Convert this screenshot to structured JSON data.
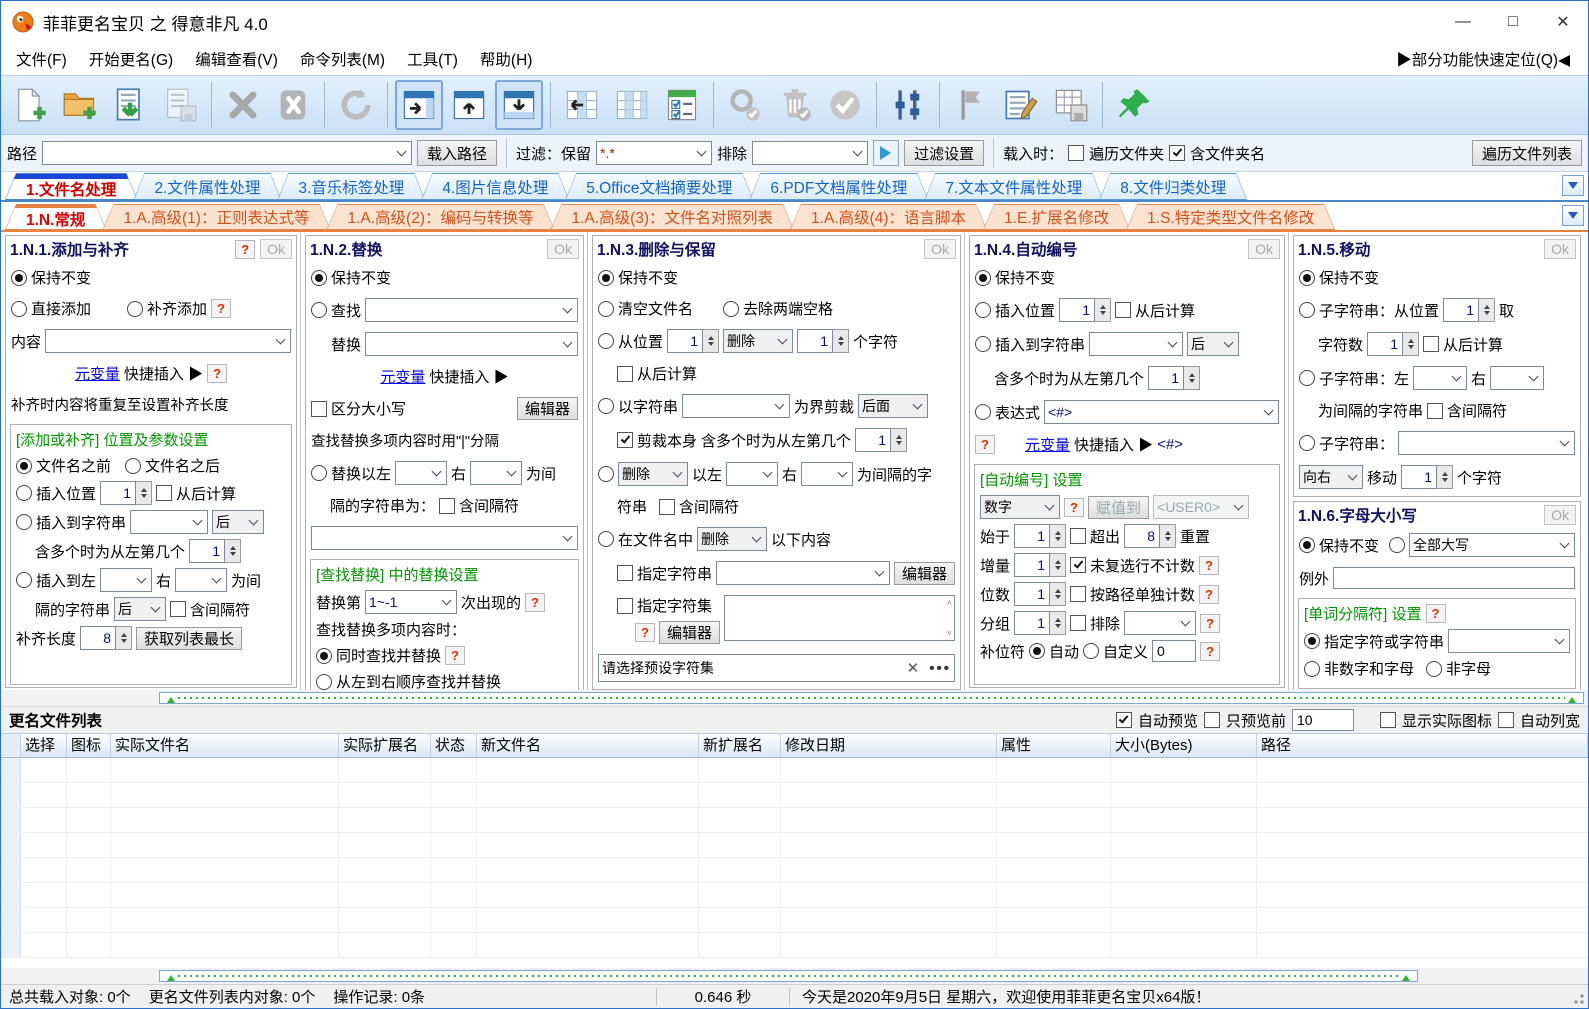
{
  "window": {
    "title": "菲菲更名宝贝 之 得意非凡 4.0",
    "minimize": "—",
    "maximize": "□",
    "close": "✕"
  },
  "menu": {
    "items": [
      "文件(F)",
      "开始更名(G)",
      "编辑查看(V)",
      "命令列表(M)",
      "工具(T)",
      "帮助(H)"
    ],
    "quick": "▶部分功能快速定位(Q)◀"
  },
  "toolbar": {
    "icons": [
      "add-files",
      "add-folder",
      "load-file-list",
      "save-file-list",
      "remove",
      "remove-all",
      "refresh",
      "panel-right",
      "panel-top",
      "panel-bottom",
      "grid-left",
      "grid-columns",
      "options-checklist",
      "search-files",
      "clean-invalid",
      "apply-check",
      "adjust-options",
      "flag-mark",
      "edit-commands",
      "table-save",
      "pin-top"
    ]
  },
  "pathbar": {
    "path_label": "路径",
    "load_path": "载入路径",
    "filter_label": "过滤：保留",
    "keep": "*.*",
    "exclude": "排除",
    "filter_set": "过滤设置",
    "on_load": "载入时：",
    "walk_folders": "遍历文件夹",
    "with_folder_name": "含文件夹名",
    "walk_list": "遍历文件列表"
  },
  "main_tabs": [
    "1.文件名处理",
    "2.文件属性处理",
    "3.音乐标签处理",
    "4.图片信息处理",
    "5.Office文档摘要处理",
    "6.PDF文档属性处理",
    "7.文本文件属性处理",
    "8.文件归类处理"
  ],
  "sub_tabs": [
    "1.N.常规",
    "1.A.高级(1)：正则表达式等",
    "1.A.高级(2)：编码与转换等",
    "1.A.高级(3)：文件名对照列表",
    "1.A.高级(4)：语言脚本",
    "1.E.扩展名修改",
    "1.S.特定类型文件名修改"
  ],
  "c": {
    "ok": "Ok",
    "help": "?",
    "keep": "保持不变",
    "from_back": "从后计算",
    "incl_sep": "含间隔符",
    "editor": "编辑器",
    "after": "后",
    "right_lbl": "右",
    "nth_lbl": "含多个时为从左第几个",
    "metavar": "元变量",
    "quick": "快捷插入 ▶",
    "del": "删除"
  },
  "p1": {
    "title": "1.N.1.添加与补齐",
    "direct": "直接添加",
    "pad": "补齐添加",
    "content": "内容",
    "note": "补齐时内容将重复至设置补齐长度",
    "group": "[添加或补齐] 位置及参数设置",
    "before": "文件名之前",
    "after_name": "文件名之后",
    "ins_pos": "插入位置",
    "pos_val": "1",
    "ins_str": "插入到字符串",
    "after_val": "后",
    "nth_val": "1",
    "ins_between": "插入到左",
    "between_tail": "为间",
    "sep_str": "隔的字符串",
    "sep_pos": "后",
    "pad_len": "补齐长度",
    "pad_val": "8",
    "get_longest": "获取列表最长"
  },
  "p2": {
    "title": "1.N.2.替换",
    "find": "查找",
    "repl": "替换",
    "case": "区分大小写",
    "note": "查找替换多项内容时用\"|\"分隔",
    "repl_left": "替换以左",
    "mid_tail": "为间",
    "sep_line": "隔的字符串为：",
    "group": "[查找替换] 中的替换设置",
    "nth_pre": "替换第",
    "nth_val": "1~-1",
    "nth_post": "次出现的",
    "multi": "查找替换多项内容时：",
    "same_time": "同时查找并替换",
    "ltr": "从左到右顺序查找并替换"
  },
  "p3": {
    "title": "1.N.3.删除与保留",
    "clear": "清空文件名",
    "trim": "去除两端空格",
    "from_pos": "从位置",
    "pos_val": "1",
    "del_val": "删除",
    "cnt_val": "1",
    "chars": "个字符",
    "by_str": "以字符串",
    "cut": "为界剪裁",
    "cut_val": "后面",
    "cut_self": "剪裁本身",
    "nth_val": "1",
    "left_lbl": "以左",
    "between_tail": "为间隔的字",
    "str_cont": "符串",
    "in_name": "在文件名中",
    "following": "以下内容",
    "spec_str": "指定字符串",
    "spec_set": "指定字符集",
    "preset": "请选择预设字符集",
    "clear_x": "✕",
    "more": "•••"
  },
  "p4": {
    "title": "1.N.4.自动编号",
    "ins_pos": "插入位置",
    "pos_val": "1",
    "ins_str": "插入到字符串",
    "after_val": "后",
    "nth_val": "1",
    "expr": "表达式",
    "expr_val": "<#>",
    "expr_tag": "<#>",
    "group": "[自动编号] 设置",
    "num_type": "数字",
    "assign": "赋值到",
    "assign_val": "<USER0>",
    "start": "始于",
    "start_val": "1",
    "over": "超出",
    "over_val": "8",
    "reset": "重置",
    "inc": "增量",
    "inc_val": "1",
    "no_uncheck": "未复选行不计数",
    "digits": "位数",
    "digits_val": "1",
    "per_path": "按路径单独计数",
    "grp": "分组",
    "grp_val": "1",
    "excl": "排除",
    "pad_lbl": "补位符",
    "auto": "自动",
    "custom": "自定义",
    "pad_val": "0"
  },
  "p5": {
    "title": "1.N.5.移动",
    "sub_pos": "子字符串：从位置",
    "pos_val": "1",
    "take": "取",
    "char_cnt": "字符数",
    "cnt_val": "1",
    "sub_lr": "子字符串：左",
    "sep_str": "为间隔的字符串",
    "sub": "子字符串：",
    "dir_val": "向右",
    "move": "移动",
    "move_val": "1",
    "chars": "个字符"
  },
  "p6": {
    "title": "1.N.6.字母大小写",
    "case_val": "全部大写",
    "except": "例外",
    "group": "[单词分隔符] 设置",
    "spec": "指定字符或字符串",
    "non_alnum": "非数字和字母",
    "non_alpha": "非字母"
  },
  "list": {
    "title": "更名文件列表",
    "auto_preview": "自动预览",
    "preview_first": "只预览前",
    "preview_count": "10",
    "show_icon": "显示实际图标",
    "auto_width": "自动列宽",
    "columns": [
      "选择",
      "图标",
      "实际文件名",
      "实际扩展名",
      "状态",
      "新文件名",
      "新扩展名",
      "修改日期",
      "属性",
      "大小(Bytes)",
      "路径"
    ]
  },
  "status": {
    "objects": "总共载入对象: 0个",
    "list_objects": "更名文件列表内对象: 0个",
    "records": "操作记录: 0条",
    "time": "0.646 秒",
    "welcome": "今天是2020年9月5日 星期六，欢迎使用菲菲更名宝贝x64版！"
  }
}
